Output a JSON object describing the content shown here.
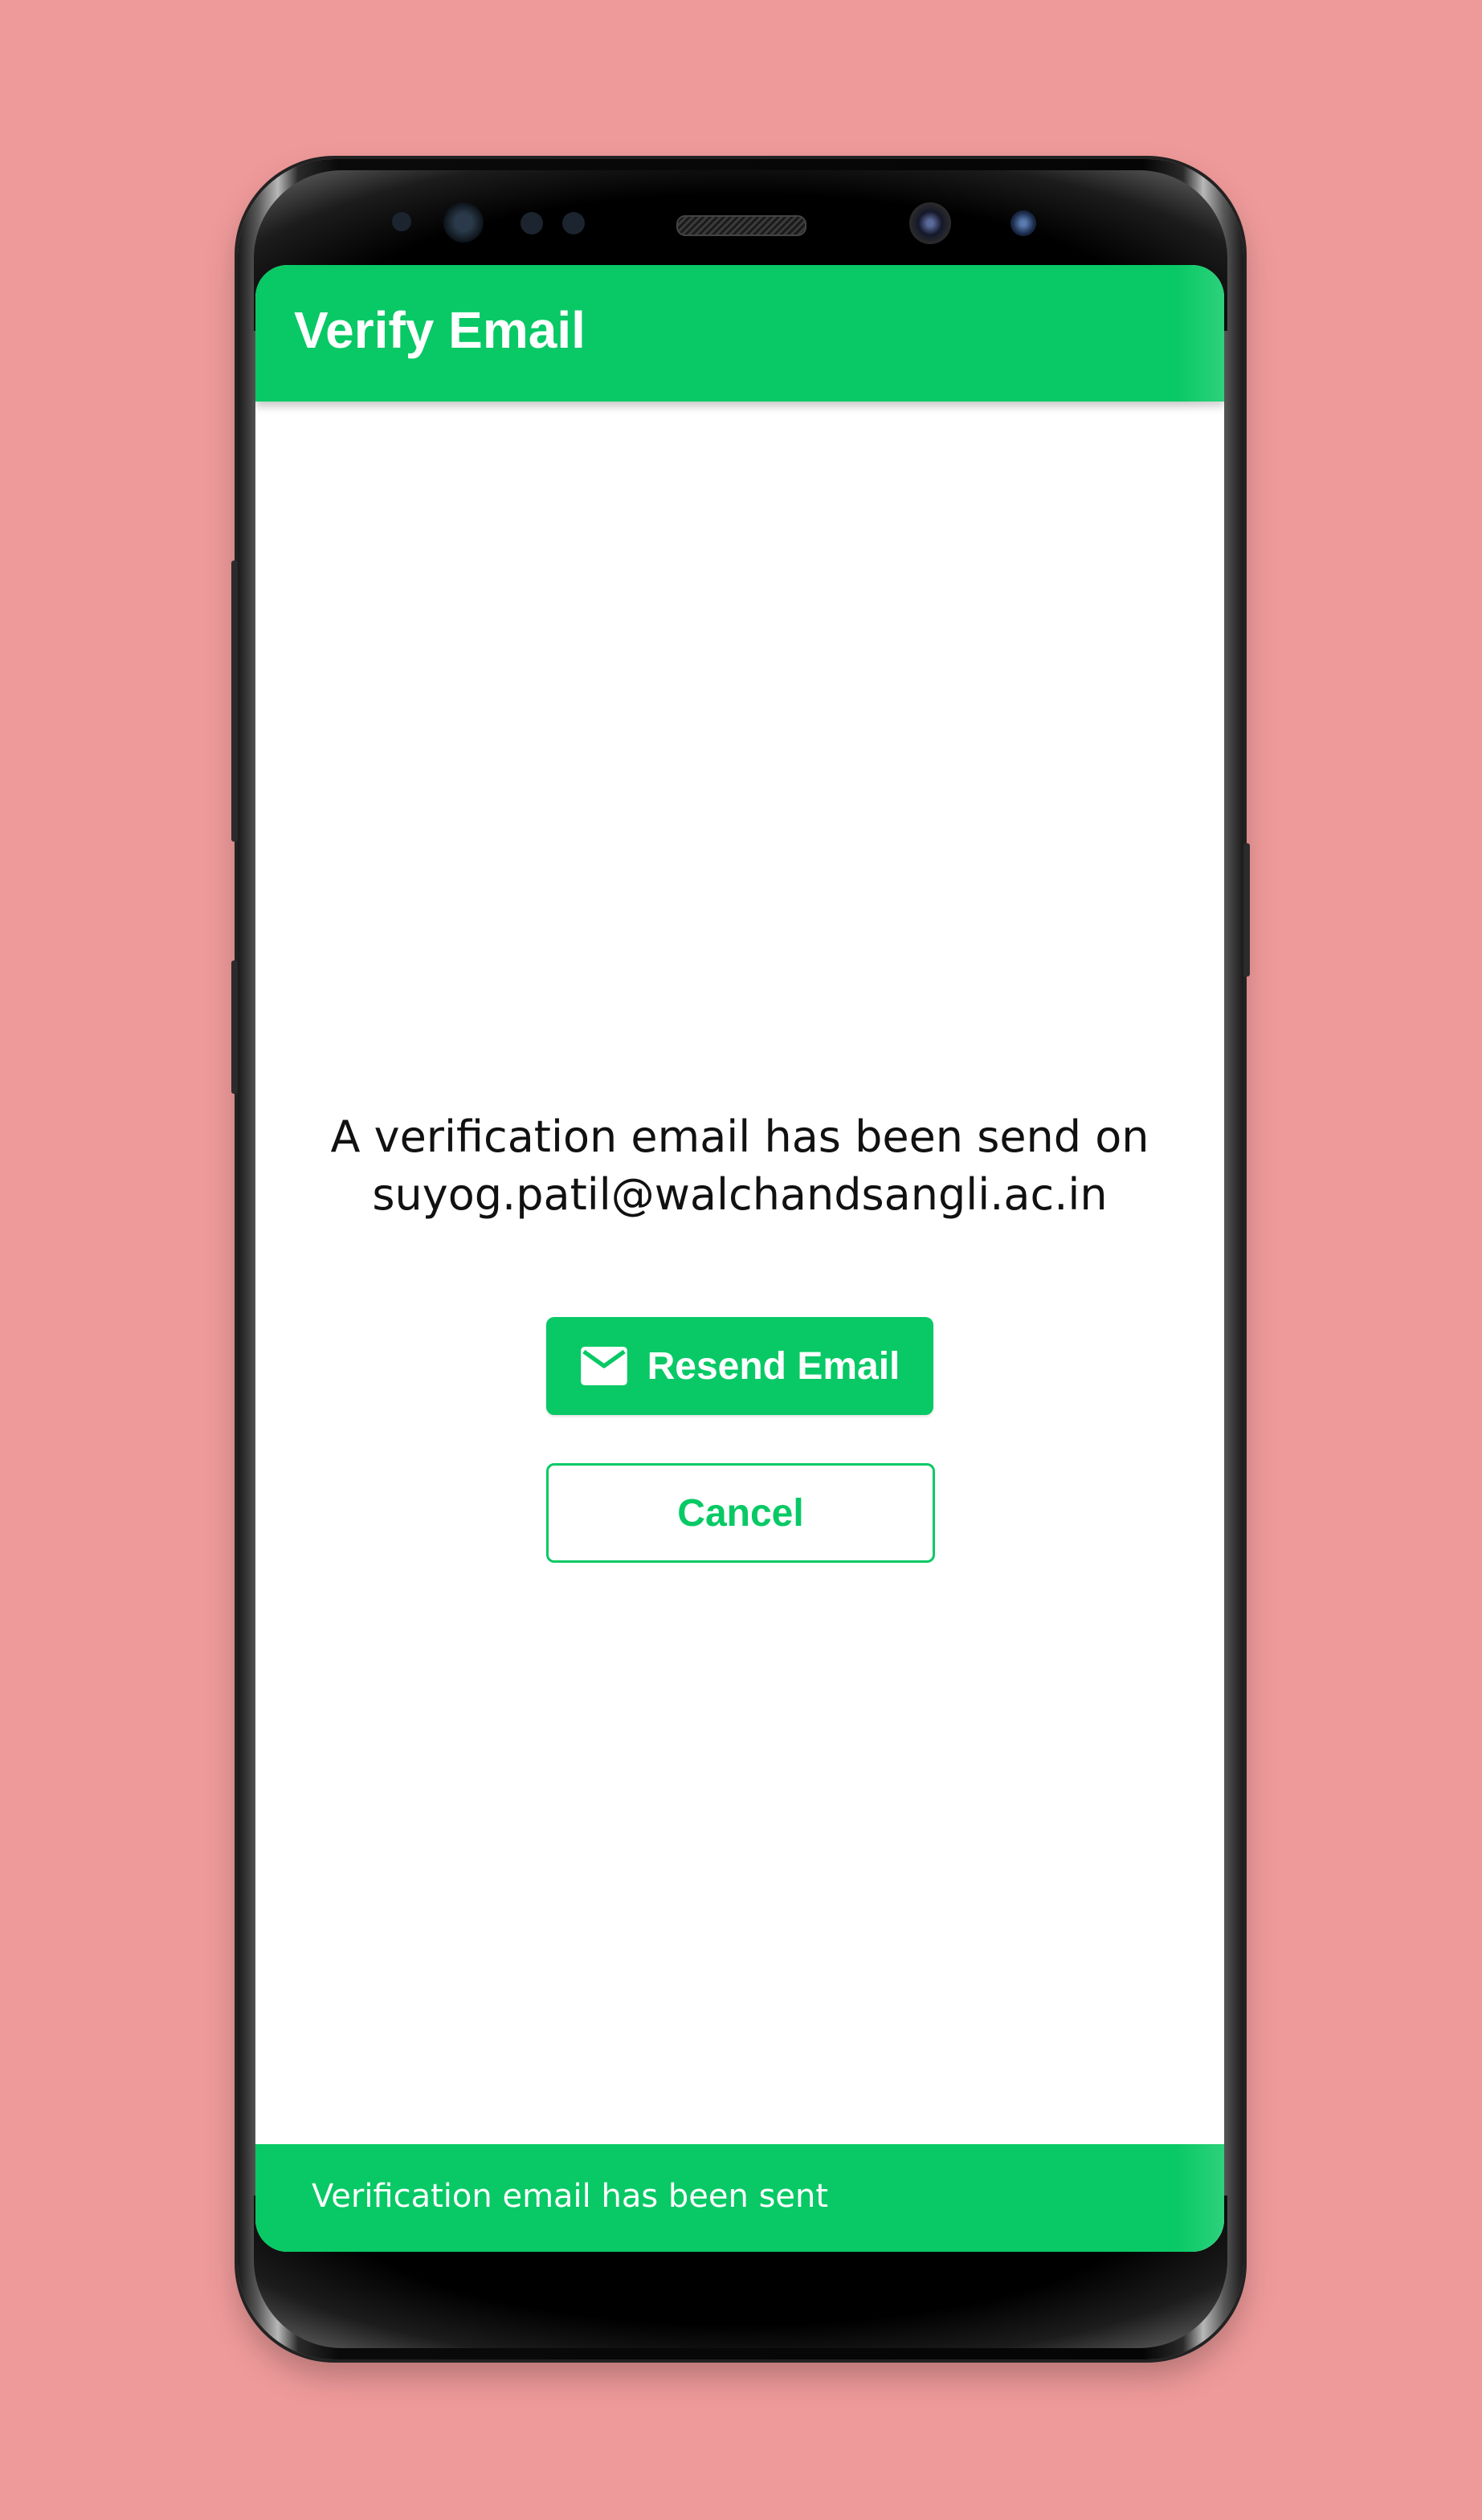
{
  "appbar": {
    "title": "Verify Email"
  },
  "main": {
    "message_line1": "A verification email has been send on",
    "message_line2": "suyog.patil@walchandsangli.ac.in",
    "resend_button": {
      "label": "Resend Email",
      "icon": "mail-icon"
    },
    "cancel_button": {
      "label": "Cancel"
    }
  },
  "snackbar": {
    "text": "Verification email has been sent"
  },
  "colors": {
    "accent": "#08C965",
    "background": "#EF9A9A",
    "text": "#111111"
  }
}
